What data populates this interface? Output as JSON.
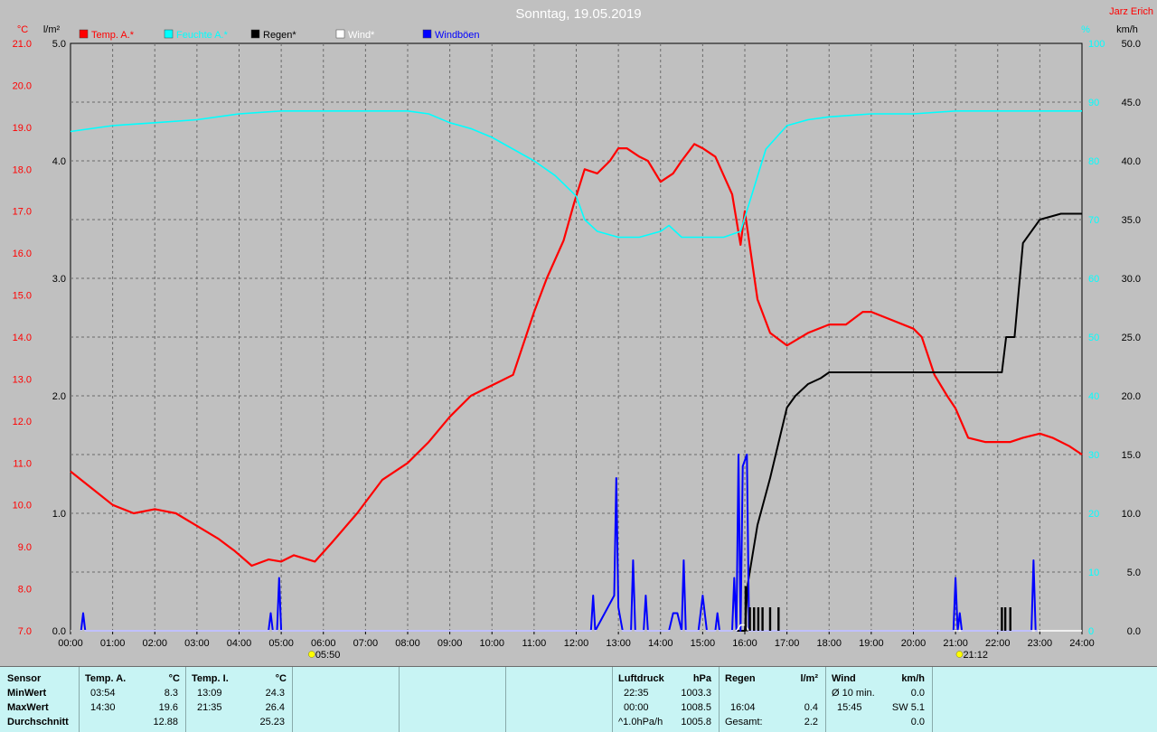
{
  "chart_data": {
    "type": "line",
    "title": "Sonntag, 19.05.2019",
    "credit": "Jarz Erich",
    "x_ticks": [
      "00:00",
      "01:00",
      "02:00",
      "03:00",
      "04:00",
      "05:00",
      "06:00",
      "07:00",
      "08:00",
      "09:00",
      "10:00",
      "11:00",
      "12:00",
      "13:00",
      "14:00",
      "15:00",
      "16:00",
      "17:00",
      "18:00",
      "19:00",
      "20:00",
      "21:00",
      "22:00",
      "23:00",
      "24:00"
    ],
    "x_range_hours": [
      0,
      24
    ],
    "sunrise": "05:50",
    "sunset": "21:12",
    "sunrise_hour": 5.83,
    "sunset_hour": 21.2,
    "axes": {
      "temp": {
        "unit": "°C",
        "min": 7,
        "max": 21,
        "ticks": [
          "7.0",
          "8.0",
          "9.0",
          "10.0",
          "11.0",
          "12.0",
          "13.0",
          "14.0",
          "15.0",
          "16.0",
          "17.0",
          "18.0",
          "19.0",
          "20.0",
          "21.0"
        ]
      },
      "rain": {
        "unit": "l/m²",
        "min": 0,
        "max": 5,
        "ticks": [
          "0.0",
          "1.0",
          "2.0",
          "3.0",
          "4.0",
          "5.0"
        ]
      },
      "humidity": {
        "unit": "%",
        "min": 0,
        "max": 100,
        "ticks": [
          "0",
          "10",
          "20",
          "30",
          "40",
          "50",
          "60",
          "70",
          "80",
          "90",
          "100"
        ]
      },
      "wind": {
        "unit": "km/h",
        "min": 0,
        "max": 50,
        "ticks": [
          "0.0",
          "5.0",
          "10.0",
          "15.0",
          "20.0",
          "25.0",
          "30.0",
          "35.0",
          "40.0",
          "45.0",
          "50.0"
        ]
      }
    },
    "grid": true,
    "legend": [
      {
        "name": "Temp. A.*",
        "color": "#ff0000"
      },
      {
        "name": "Feuchte A.*",
        "color": "#00ffff"
      },
      {
        "name": "Regen*",
        "color": "#000000"
      },
      {
        "name": "Wind*",
        "color": "#ffffff"
      },
      {
        "name": "Windböen",
        "color": "#0000ff"
      }
    ],
    "series": [
      {
        "name": "Temp. A.*",
        "axis": "temp",
        "color": "#ff0000",
        "x": [
          0,
          0.5,
          1,
          1.5,
          2,
          2.5,
          3,
          3.5,
          3.9,
          4.3,
          4.7,
          5,
          5.3,
          5.8,
          6.2,
          6.8,
          7.4,
          8,
          8.5,
          9,
          9.5,
          10,
          10.1,
          10.5,
          11,
          11.3,
          11.7,
          11.95,
          12.2,
          12.5,
          12.8,
          13,
          13.2,
          13.5,
          13.7,
          14,
          14.3,
          14.5,
          14.8,
          15,
          15.3,
          15.7,
          15.9,
          16,
          16.3,
          16.6,
          17,
          17.5,
          18,
          18.4,
          18.8,
          19,
          19.5,
          20,
          20.2,
          20.5,
          20.8,
          21,
          21.3,
          21.7,
          22,
          22.3,
          22.6,
          23,
          23.3,
          23.7,
          24
        ],
        "y": [
          10.8,
          10.4,
          10,
          9.8,
          9.9,
          9.8,
          9.5,
          9.2,
          8.9,
          8.55,
          8.7,
          8.65,
          8.8,
          8.65,
          9.1,
          9.8,
          10.6,
          11,
          11.5,
          12.1,
          12.6,
          12.85,
          12.9,
          13.1,
          14.6,
          15.4,
          16.3,
          17.2,
          18,
          17.9,
          18.2,
          18.5,
          18.5,
          18.3,
          18.2,
          17.7,
          17.9,
          18.2,
          18.6,
          18.5,
          18.3,
          17.4,
          16.2,
          17,
          14.9,
          14.1,
          13.8,
          14.1,
          14.3,
          14.3,
          14.6,
          14.6,
          14.4,
          14.2,
          14,
          13.1,
          12.6,
          12.3,
          11.6,
          11.5,
          11.5,
          11.5,
          11.6,
          11.7,
          11.6,
          11.4,
          11.2
        ]
      },
      {
        "name": "Feuchte A.*",
        "axis": "humidity",
        "color": "#00ffff",
        "x": [
          0,
          1,
          2,
          3,
          4,
          5,
          6,
          7,
          8,
          8.5,
          9,
          9.5,
          10,
          10.5,
          11,
          11.5,
          12,
          12.2,
          12.5,
          13,
          13.5,
          14,
          14.2,
          14.5,
          15,
          15.5,
          15.9,
          16.2,
          16.5,
          17,
          17.5,
          18,
          19,
          20,
          21,
          22,
          23,
          24
        ],
        "y": [
          85,
          86,
          86.5,
          87,
          88,
          88.5,
          88.5,
          88.5,
          88.5,
          88,
          86.5,
          85.5,
          84,
          82,
          80,
          77.5,
          74,
          70,
          68,
          67,
          67,
          68,
          69,
          67,
          67,
          67,
          68,
          75,
          82,
          86,
          87,
          87.5,
          88,
          88,
          88.5,
          88.5,
          88.5,
          88.5
        ]
      },
      {
        "name": "Regen*",
        "axis": "rain",
        "color": "#000000",
        "x": [
          0,
          16,
          16.07,
          16.3,
          16.6,
          16.8,
          17,
          17.2,
          17.5,
          17.8,
          18,
          19,
          20,
          21,
          22,
          22.1,
          22.2,
          22.4,
          22.6,
          23,
          23.5,
          24
        ],
        "y": [
          0,
          0,
          0.4,
          0.9,
          1.3,
          1.6,
          1.9,
          2,
          2.1,
          2.15,
          2.2,
          2.2,
          2.2,
          2.2,
          2.2,
          2.2,
          2.5,
          2.5,
          3.3,
          3.5,
          3.55,
          3.55
        ]
      },
      {
        "name": "Windböen",
        "axis": "wind",
        "color": "#0000ff",
        "x": [
          0.25,
          0.3,
          0.35,
          4.7,
          4.75,
          4.8,
          4.9,
          4.95,
          5,
          12.35,
          12.4,
          12.45,
          12.9,
          12.95,
          13,
          13.1,
          13.3,
          13.35,
          13.4,
          13.6,
          13.65,
          13.7,
          14.2,
          14.3,
          14.4,
          14.5,
          14.55,
          14.6,
          14.9,
          15,
          15.1,
          15.3,
          15.35,
          15.4,
          15.7,
          15.75,
          15.8,
          15.85,
          15.9,
          15.95,
          16.05,
          16.1,
          16.15,
          16.25,
          20.95,
          21,
          21.05,
          21.1,
          21.15,
          22.7,
          22.8,
          22.85,
          22.9,
          22.95
        ],
        "y": [
          0,
          1.5,
          0,
          0,
          1.5,
          0,
          0,
          4.5,
          0,
          0,
          3,
          0,
          3,
          13,
          2,
          0,
          0,
          6,
          0,
          0,
          3,
          0,
          0,
          1.5,
          1.5,
          0,
          6,
          0,
          0,
          3,
          0,
          0,
          1.5,
          0,
          0,
          4.5,
          0,
          15,
          0,
          14,
          15,
          0,
          0,
          0,
          0,
          4.5,
          0,
          1.5,
          0,
          0,
          0,
          6,
          0,
          0
        ]
      },
      {
        "name": "Wind*",
        "axis": "wind",
        "color": "#ffffff",
        "x": [
          0,
          15.8,
          15.9,
          16,
          16.1,
          24
        ],
        "y": [
          0,
          0,
          0.5,
          0.5,
          0,
          0
        ]
      }
    ],
    "rain_bars": {
      "axis": "rain",
      "color": "#000000",
      "x": [
        16.02,
        16.12,
        16.22,
        16.32,
        16.42,
        16.6,
        16.8,
        22.1,
        22.18,
        22.3
      ],
      "y": [
        0.38,
        0.2,
        0.2,
        0.2,
        0.2,
        0.2,
        0.2,
        0.2,
        0.2,
        0.2
      ]
    }
  },
  "stats": {
    "sensor": {
      "label": "Sensor",
      "rows": [
        "MinWert",
        "MaxWert",
        "Durchschnitt"
      ]
    },
    "temp_a": {
      "label": "Temp. A.",
      "unit": "°C",
      "min_time": "03:54",
      "min_val": "8.3",
      "max_time": "14:30",
      "max_val": "19.6",
      "avg": "12.88"
    },
    "temp_i": {
      "label": "Temp. I.",
      "unit": "°C",
      "min_time": "13:09",
      "min_val": "24.3",
      "max_time": "21:35",
      "max_val": "26.4",
      "avg": "25.23"
    },
    "luftdruck": {
      "label": "Luftdruck",
      "unit": "hPa",
      "r1_label": "22:35",
      "r1_val": "1003.3",
      "r2_label": "00:00",
      "r2_val": "1008.5",
      "r3_label": "^1.0hPa/h",
      "r3_val": "1005.8"
    },
    "regen": {
      "label": "Regen",
      "unit": "l/m²",
      "r2_label": "16:04",
      "r2_val": "0.4",
      "r3_label": "Gesamt:",
      "r3_val": "2.2"
    },
    "wind": {
      "label": "Wind",
      "unit": "km/h",
      "r1_label": "Ø 10 min.",
      "r1_val": "0.0",
      "r2_label": "15:45",
      "r2_val": "SW 5.1",
      "r3_val": "0.0"
    }
  }
}
